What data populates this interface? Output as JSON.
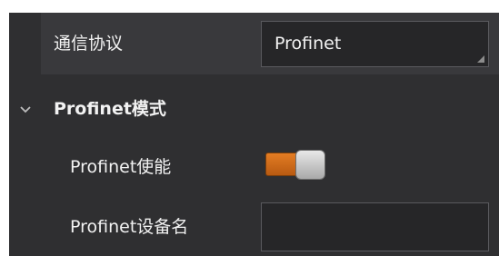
{
  "rows": {
    "protocol": {
      "label": "通信协议",
      "value": "Profinet"
    },
    "section": {
      "title": "Profinet模式",
      "expanded": true
    },
    "enable": {
      "label": "Profinet使能",
      "checked": true
    },
    "device_name": {
      "label": "Profinet设备名",
      "value": ""
    }
  },
  "colors": {
    "panel_bg": "#2f2f31",
    "selected_row_bg": "#39393c",
    "field_bg": "#262628",
    "text": "#f2f2f2",
    "toggle_on": "#d46f1b"
  },
  "icons": {
    "section_toggle": "chevron-down-icon",
    "field_corner": "resize-grip-icon"
  }
}
